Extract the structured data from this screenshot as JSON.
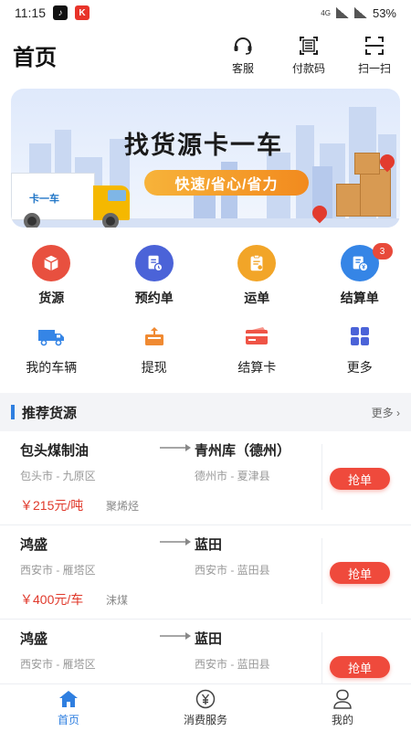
{
  "status_bar": {
    "time": "11:15",
    "network": "4G",
    "battery": "53%"
  },
  "header": {
    "title": "首页",
    "actions": [
      {
        "label": "客服",
        "icon": "headset-icon"
      },
      {
        "label": "付款码",
        "icon": "qrcode-icon"
      },
      {
        "label": "扫一扫",
        "icon": "scan-icon"
      }
    ]
  },
  "banner": {
    "title": "找货源卡一车",
    "subtitle": "快速/省心/省力",
    "truck_logo": "卡一车"
  },
  "primary_grid": [
    {
      "label": "货源",
      "icon": "box-icon",
      "color": "#e8503f"
    },
    {
      "label": "预约单",
      "icon": "calendar-doc-icon",
      "color": "#4b63d8"
    },
    {
      "label": "运单",
      "icon": "clipboard-icon",
      "color": "#f2a528"
    },
    {
      "label": "结算单",
      "icon": "yuan-doc-icon",
      "color": "#3585e6",
      "badge": "3"
    }
  ],
  "secondary_grid": [
    {
      "label": "我的车辆",
      "icon": "truck-icon",
      "color": "#3585e6"
    },
    {
      "label": "提现",
      "icon": "withdraw-icon",
      "color": "#f08a32"
    },
    {
      "label": "结算卡",
      "icon": "card-icon",
      "color": "#ef5446"
    },
    {
      "label": "更多",
      "icon": "grid-icon",
      "color": "#4b63d8"
    }
  ],
  "section": {
    "title": "推荐货源",
    "more": "更多 ›"
  },
  "cargo": [
    {
      "from": "包头煤制油",
      "to": "青州库（德州）",
      "from_area": "包头市 - 九原区",
      "to_area": "德州市 - 夏津县",
      "price": "￥215元/吨",
      "goods": "聚烯烃",
      "action": "抢单"
    },
    {
      "from": "鸿盛",
      "to": "蓝田",
      "from_area": "西安市 - 雁塔区",
      "to_area": "西安市 - 蓝田县",
      "price": "￥400元/车",
      "goods": "沫煤",
      "action": "抢单"
    },
    {
      "from": "鸿盛",
      "to": "蓝田",
      "from_area": "西安市 - 雁塔区",
      "to_area": "西安市 - 蓝田县",
      "price": "",
      "goods": "",
      "action": "抢单"
    }
  ],
  "bottom_nav": [
    {
      "label": "首页",
      "icon": "home-icon",
      "active": true
    },
    {
      "label": "消费服务",
      "icon": "yuan-circle-icon",
      "active": false
    },
    {
      "label": "我的",
      "icon": "user-icon",
      "active": false
    }
  ],
  "colors": {
    "accent": "#2f7fe0",
    "grab": "#ef4a3c",
    "price": "#e0392b"
  }
}
